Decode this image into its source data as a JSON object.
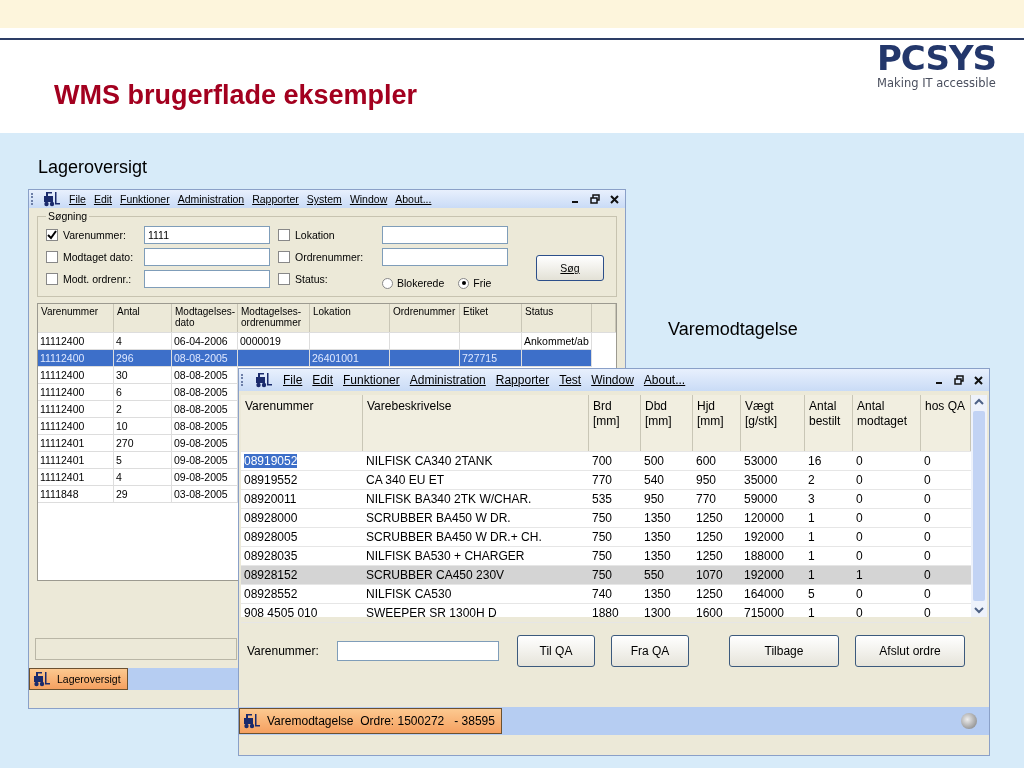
{
  "slide": {
    "title": "WMS brugerflade eksempler",
    "logo": {
      "name": "PCSYS",
      "tagline": "Making IT accessible"
    },
    "captions": [
      "Lageroversigt",
      "Varemodtagelse"
    ]
  },
  "window1": {
    "menu": [
      "File",
      "Edit",
      "Funktioner",
      "Administration",
      "Rapporter",
      "System",
      "Window",
      "About..."
    ],
    "search": {
      "title": "Søgning",
      "fields": [
        {
          "kind": "text",
          "label": "Varenummer:",
          "checked": true,
          "value": "1111"
        },
        {
          "kind": "text",
          "label": "Lokation",
          "checked": false
        },
        {
          "kind": "text",
          "label": "Modtaget dato:",
          "checked": false
        },
        {
          "kind": "text",
          "label": "Ordrenummer:",
          "checked": false
        },
        {
          "kind": "text",
          "label": "Modt. ordrenr.:",
          "checked": false
        },
        {
          "kind": "radio",
          "label": "Status:",
          "checked": false,
          "options": [
            {
              "label": "Blokerede",
              "selected": false
            },
            {
              "label": "Frie",
              "selected": true
            }
          ]
        }
      ],
      "button": "Søg"
    },
    "table": {
      "columns": [
        "Varenummer",
        "Antal",
        "Modtagelses-dato",
        "Modtagelses-ordrenummer",
        "Lokation",
        "Ordrenummer",
        "Etiket",
        "Status"
      ],
      "rows": [
        {
          "selected": false,
          "cells": [
            "11112400",
            "4",
            "06-04-2006",
            "0000019",
            null,
            null,
            null,
            "Ankommet/ab"
          ]
        },
        {
          "selected": true,
          "cells": [
            "11112400",
            "296",
            "08-08-2005",
            null,
            "26401001",
            null,
            "727715",
            null
          ]
        },
        {
          "selected": false,
          "cells": [
            "11112400",
            "30",
            "08-08-2005"
          ]
        },
        {
          "selected": false,
          "cells": [
            "11112400",
            "6",
            "08-08-2005"
          ]
        },
        {
          "selected": false,
          "cells": [
            "11112400",
            "2",
            "08-08-2005"
          ]
        },
        {
          "selected": false,
          "cells": [
            "11112400",
            "10",
            "08-08-2005"
          ]
        },
        {
          "selected": false,
          "cells": [
            "11112401",
            "270",
            "09-08-2005"
          ]
        },
        {
          "selected": false,
          "cells": [
            "11112401",
            "5",
            "09-08-2005"
          ]
        },
        {
          "selected": false,
          "cells": [
            "11112401",
            "4",
            "09-08-2005"
          ]
        },
        {
          "selected": false,
          "cells": [
            "1111848",
            "29",
            "03-08-2005"
          ]
        }
      ]
    },
    "taskbar": "Lageroversigt"
  },
  "window2": {
    "menu": [
      "File",
      "Edit",
      "Funktioner",
      "Administration",
      "Rapporter",
      "Test",
      "Window",
      "About..."
    ],
    "table": {
      "columns": [
        "Varenummer",
        "Varebeskrivelse",
        "Brd [mm]",
        "Dbd [mm]",
        "Hjd [mm]",
        "Vægt [g/stk]",
        "Antal bestilt",
        "Antal modtaget",
        "hos QA"
      ],
      "rows": [
        {
          "selected": false,
          "focused": true,
          "cells": [
            "08919052",
            "NILFISK CA340 2TANK",
            "700",
            "500",
            "600",
            "53000",
            "16",
            "0",
            "0"
          ]
        },
        {
          "selected": false,
          "focused": false,
          "cells": [
            "08919552",
            "CA 340 EU ET",
            "770",
            "540",
            "950",
            "35000",
            "2",
            "0",
            "0"
          ]
        },
        {
          "selected": false,
          "focused": false,
          "cells": [
            "08920011",
            "NILFISK BA340 2TK W/CHAR.",
            "535",
            "950",
            "770",
            "59000",
            "3",
            "0",
            "0"
          ]
        },
        {
          "selected": false,
          "focused": false,
          "cells": [
            "08928000",
            "SCRUBBER BA450 W DR.",
            "750",
            "1350",
            "1250",
            "120000",
            "1",
            "0",
            "0"
          ]
        },
        {
          "selected": false,
          "focused": false,
          "cells": [
            "08928005",
            "SCRUBBER BA450 W DR.+ CH.",
            "750",
            "1350",
            "1250",
            "192000",
            "1",
            "0",
            "0"
          ]
        },
        {
          "selected": false,
          "focused": false,
          "cells": [
            "08928035",
            "NILFISK BA530 + CHARGER",
            "750",
            "1350",
            "1250",
            "188000",
            "1",
            "0",
            "0"
          ]
        },
        {
          "selected": true,
          "focused": false,
          "cells": [
            "08928152",
            "SCRUBBER CA450 230V",
            "750",
            "550",
            "1070",
            "192000",
            "1",
            "1",
            "0"
          ]
        },
        {
          "selected": false,
          "focused": false,
          "cells": [
            "08928552",
            "NILFISK CA530",
            "740",
            "1350",
            "1250",
            "164000",
            "5",
            "0",
            "0"
          ]
        },
        {
          "selected": false,
          "focused": false,
          "cells": [
            "908 4505 010",
            "SWEEPER SR 1300H D",
            "1880",
            "1300",
            "1600",
            "715000",
            "1",
            "0",
            "0"
          ]
        }
      ]
    },
    "input_label": "Varenummer:",
    "buttons": [
      "Til QA",
      "Fra QA",
      "Tilbage",
      "Afslut ordre"
    ],
    "taskbar": "Varemodtagelse  Ordre: 1500272   - 38595"
  }
}
